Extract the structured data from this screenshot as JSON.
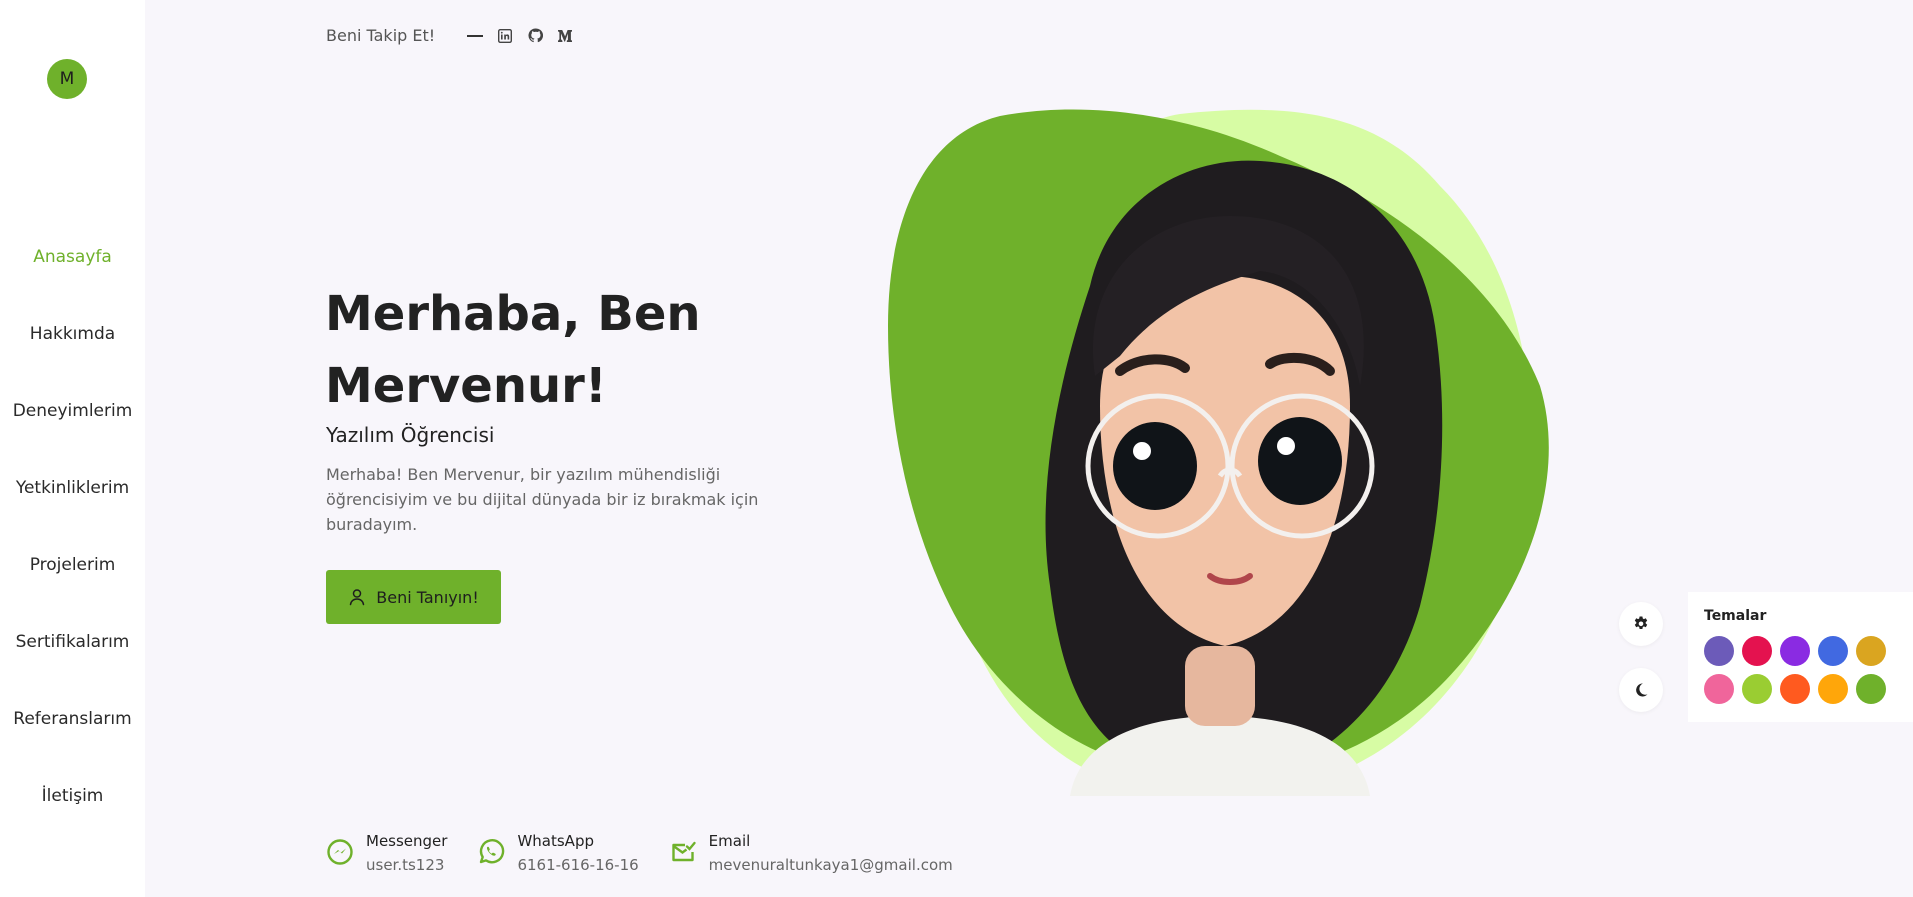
{
  "brand": {
    "logo_letter": "M"
  },
  "nav": {
    "items": [
      {
        "label": "Anasayfa",
        "active": true
      },
      {
        "label": "Hakkımda"
      },
      {
        "label": "Deneyimlerim"
      },
      {
        "label": "Yetkinliklerim"
      },
      {
        "label": "Projelerim"
      },
      {
        "label": "Sertifikalarım"
      },
      {
        "label": "Referanslarım"
      },
      {
        "label": "İletişim"
      }
    ]
  },
  "header": {
    "follow_label": "Beni Takip Et!",
    "social": [
      "linkedin-icon",
      "github-icon",
      "medium-icon"
    ]
  },
  "hero": {
    "title_line1": "Merhaba, Ben",
    "title_line2": "Mervenur!",
    "subtitle": "Yazılım Öğrencisi",
    "description": "Merhaba! Ben Mervenur, bir yazılım mühendisliği öğrencisiyim ve bu dijital dünyada bir iz bırakmak için buradayım.",
    "cta_label": "Beni Tanıyın!"
  },
  "contacts": [
    {
      "title": "Messenger",
      "value": "user.ts123",
      "icon": "messenger-icon"
    },
    {
      "title": "WhatsApp",
      "value": "6161-616-16-16",
      "icon": "whatsapp-icon"
    },
    {
      "title": "Email",
      "value": "mevenuraltunkaya1@gmail.com",
      "icon": "email-icon"
    }
  ],
  "themes": {
    "title": "Temalar",
    "colors": [
      "#6c5bb9",
      "#e4124f",
      "#8a2be2",
      "#4169e1",
      "#daa520",
      "#f0659b",
      "#9acd32",
      "#ff5a1f",
      "#ffa60a",
      "#6fb12b"
    ]
  },
  "colors": {
    "accent": "#6fb12b",
    "blob_light": "#d7fca4",
    "background": "#f8f6fb"
  }
}
